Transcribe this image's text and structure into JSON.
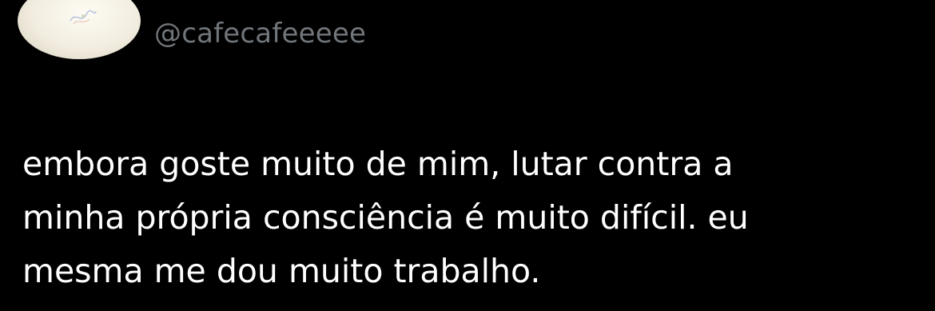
{
  "tweet": {
    "handle": "@cafecafeeeee",
    "text_lines": [
      "embora goste muito de mim, lutar contra a",
      "minha própria consciência é muito difícil. eu",
      "mesma me dou muito trabalho."
    ]
  },
  "colors": {
    "background": "#000000",
    "text": "#ffffff",
    "handle": "#71767b"
  },
  "icons": {
    "avatar": "avatar-photo"
  }
}
